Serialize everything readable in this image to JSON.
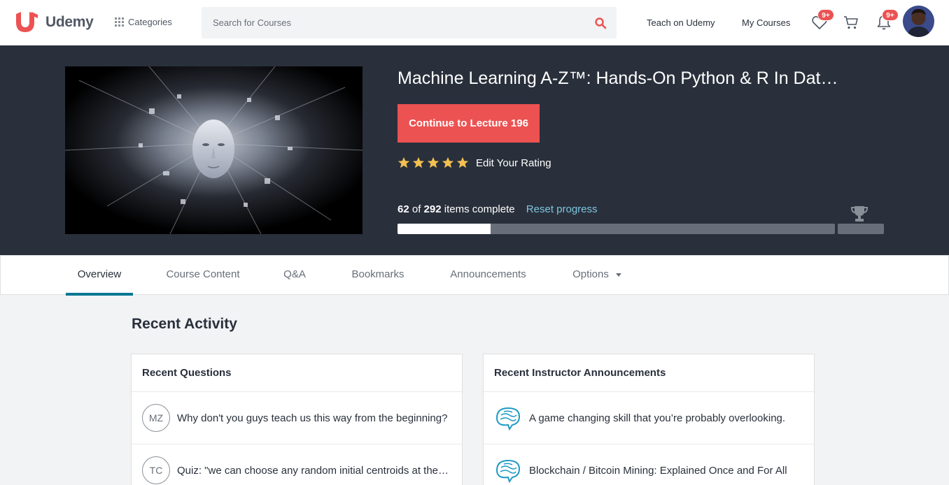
{
  "brand": {
    "name": "Udemy",
    "color": "#ec5252"
  },
  "nav": {
    "categories_label": "Categories",
    "search_placeholder": "Search for Courses",
    "teach_label": "Teach on Udemy",
    "my_courses_label": "My Courses",
    "wishlist_badge": "9+",
    "notifications_badge": "9+"
  },
  "course": {
    "title": "Machine Learning A-Z™: Hands-On Python & R In Data Sc...",
    "continue_label": "Continue to Lecture 196",
    "rating_stars": 5,
    "edit_rating_label": "Edit Your Rating",
    "progress": {
      "completed": "62",
      "of_label": "of",
      "total": "292",
      "suffix": "items complete",
      "fraction": 0.2123
    },
    "reset_label": "Reset progress"
  },
  "tabs": [
    {
      "label": "Overview",
      "active": true
    },
    {
      "label": "Course Content"
    },
    {
      "label": "Q&A"
    },
    {
      "label": "Bookmarks"
    },
    {
      "label": "Announcements"
    },
    {
      "label": "Options"
    }
  ],
  "overview": {
    "section_title": "Recent Activity",
    "questions": {
      "title": "Recent Questions",
      "items": [
        {
          "initials": "MZ",
          "text": "Why don't you guys teach us this way from the beginning?"
        },
        {
          "initials": "TC",
          "text": "Quiz: \"we can choose any random initial centroids at the start\""
        }
      ]
    },
    "announcements": {
      "title": "Recent Instructor Announcements",
      "items": [
        {
          "text": "A game changing skill that you’re probably overlooking."
        },
        {
          "text": "Blockchain / Bitcoin Mining: Explained Once and For All"
        }
      ]
    }
  },
  "colors": {
    "accent": "#ec5252",
    "hero_bg": "#29303b",
    "tab_active": "#007791",
    "star": "#f4c150",
    "link": "#7dc6e1"
  }
}
